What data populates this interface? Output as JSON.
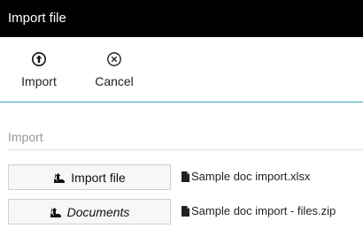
{
  "dialog": {
    "title": "Import file"
  },
  "toolbar": {
    "import_label": "Import",
    "cancel_label": "Cancel"
  },
  "section": {
    "title": "Import",
    "rows": [
      {
        "button_label": "Import file",
        "link_label": "Sample doc import.xlsx"
      },
      {
        "button_label": "Documents",
        "link_label": "Sample doc import - files.zip"
      }
    ]
  },
  "icons": {
    "import": "arrow-up-circle-icon",
    "cancel": "close-circle-icon",
    "upload": "upload-icon",
    "document": "document-icon"
  },
  "colors": {
    "titlebar_bg": "#000000",
    "accent_rule": "#3aa3c6",
    "section_title": "#999999"
  }
}
